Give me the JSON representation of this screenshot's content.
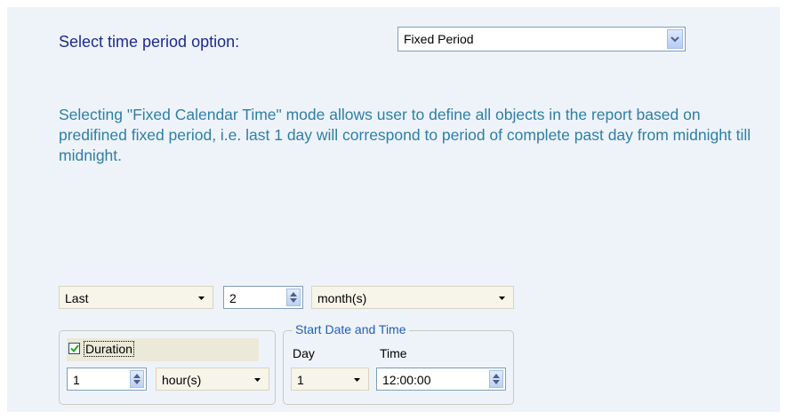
{
  "prompt_label": "Select time period option:",
  "period_select": {
    "value": "Fixed Period"
  },
  "description": "Selecting \"Fixed Calendar Time\" mode allows user to define all objects in the report based on predifined fixed period, i.e. last 1 day will correspond to period of complete past day from midnight till midnight.",
  "range": {
    "mode": "Last",
    "count": "2",
    "unit": "month(s)"
  },
  "duration": {
    "checked": true,
    "label": "Duration",
    "value": "1",
    "unit": "hour(s)"
  },
  "start": {
    "legend": "Start Date and Time",
    "day_label": "Day",
    "day_value": "1",
    "time_label": "Time",
    "time_value": "12:00:00"
  },
  "colors": {
    "label": "#1f2a8c",
    "description": "#2e7fa6",
    "legend": "#1f5fb8",
    "panel": "#eef3fa"
  }
}
